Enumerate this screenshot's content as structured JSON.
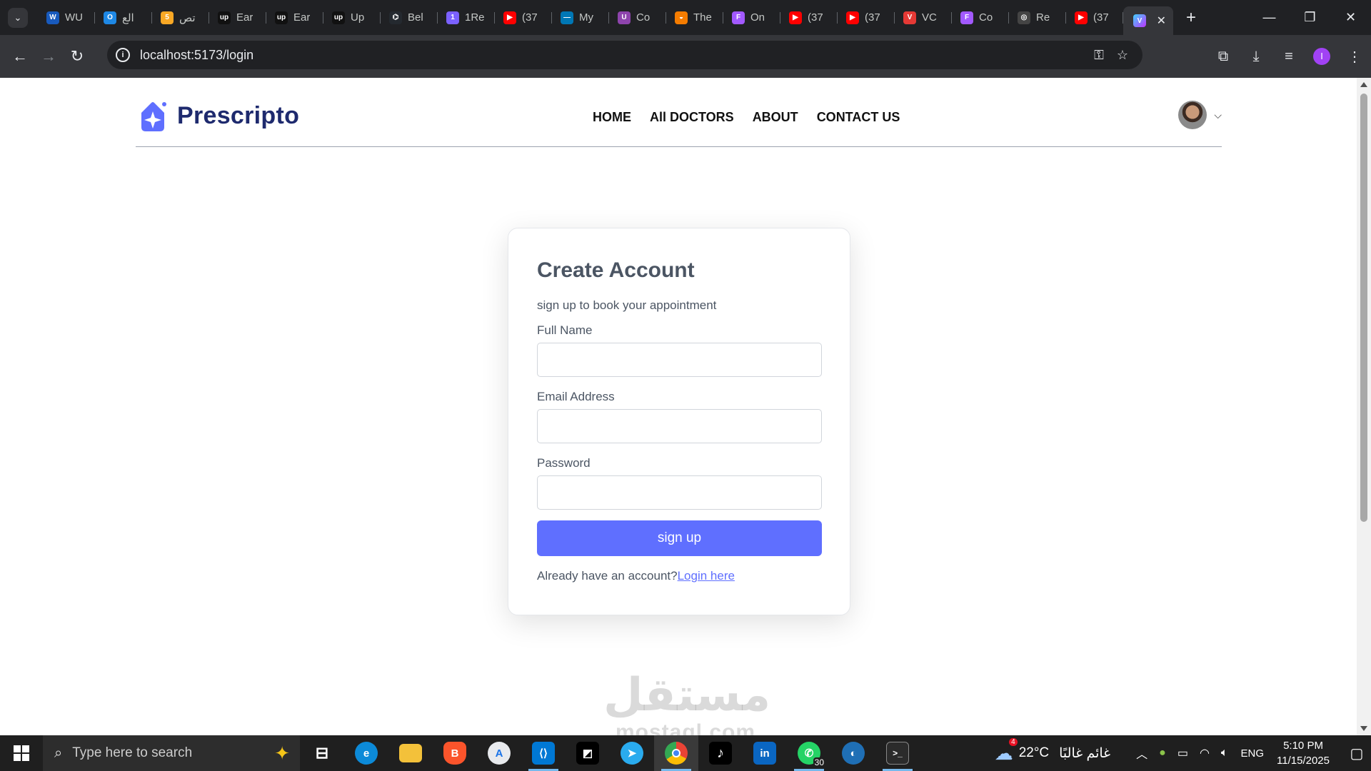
{
  "browser": {
    "tabs": [
      {
        "label": "WU",
        "fav": "W",
        "color": "#185abd"
      },
      {
        "label": "الع",
        "fav": "O",
        "color": "#1e88e5"
      },
      {
        "label": "تص",
        "fav": "5",
        "color": "#f9a825"
      },
      {
        "label": "Ear",
        "fav": "up",
        "color": "#111111"
      },
      {
        "label": "Ear",
        "fav": "up",
        "color": "#111111"
      },
      {
        "label": "Up",
        "fav": "up",
        "color": "#111111"
      },
      {
        "label": "Bel",
        "fav": "⌬",
        "color": "#24292f"
      },
      {
        "label": "1Re",
        "fav": "1",
        "color": "#7b61ff"
      },
      {
        "label": "(37",
        "fav": "▶",
        "color": "#ff0000"
      },
      {
        "label": "My",
        "fav": "—",
        "color": "#0077b5"
      },
      {
        "label": "Co",
        "fav": "U",
        "color": "#8e44ad"
      },
      {
        "label": "The",
        "fav": "◒",
        "color": "#f57c00"
      },
      {
        "label": "On",
        "fav": "F",
        "color": "#a259ff"
      },
      {
        "label": "(37",
        "fav": "▶",
        "color": "#ff0000"
      },
      {
        "label": "(37",
        "fav": "▶",
        "color": "#ff0000"
      },
      {
        "label": "VC",
        "fav": "V",
        "color": "#e53935"
      },
      {
        "label": "Co",
        "fav": "F",
        "color": "#a259ff"
      },
      {
        "label": "Re",
        "fav": "◎",
        "color": "#444444"
      },
      {
        "label": "(37",
        "fav": "▶",
        "color": "#ff0000"
      }
    ],
    "active_tab_fav": "V",
    "url": "localhost:5173/login"
  },
  "site": {
    "logo_text": "Prescripto",
    "nav": [
      "HOME",
      "All DOCTORS",
      "ABOUT",
      "CONTACT US"
    ]
  },
  "form": {
    "title": "Create Account",
    "subtitle": "sign up to book your appointment",
    "fields": [
      {
        "label": "Full Name",
        "value": ""
      },
      {
        "label": "Email Address",
        "value": ""
      },
      {
        "label": "Password",
        "value": ""
      }
    ],
    "submit_label": "sign up",
    "already_text": "Already have an account?",
    "login_link": "Login here"
  },
  "watermark": {
    "line1": "مستقل",
    "line2": "mostaql.com"
  },
  "taskbar": {
    "search_placeholder": "Type here to search",
    "whatsapp_badge": "30",
    "weather_badge": "4",
    "temperature": "22°C",
    "weather_condition": "غائم غالبًا",
    "language": "ENG",
    "time": "5:10 PM",
    "date": "11/15/2025"
  },
  "colors": {
    "accent": "#5f6fff",
    "logo": "#1e2a6e"
  }
}
